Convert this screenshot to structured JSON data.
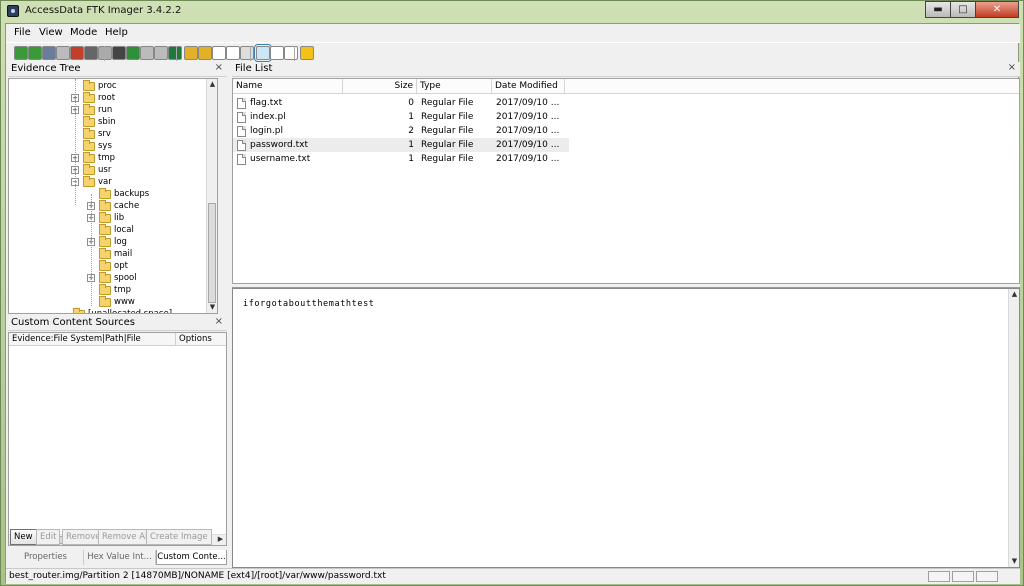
{
  "window": {
    "title": "AccessData FTK Imager 3.4.2.2"
  },
  "menu": [
    "File",
    "View",
    "Mode",
    "Help"
  ],
  "toolbar": {
    "icons": [
      {
        "name": "add-evidence-icon",
        "color": "#3a9a3a"
      },
      {
        "name": "add-all-evidence-icon",
        "color": "#3a9a3a"
      },
      {
        "name": "image-mounting-icon",
        "color": "#6a7d9a"
      },
      {
        "name": "remove-evidence-icon",
        "color": "#bbbbbb"
      },
      {
        "name": "remove-all-evidence-icon",
        "color": "#c2402b"
      },
      {
        "name": "create-image-icon",
        "color": "#666666"
      },
      {
        "name": "export-disk-image-icon",
        "color": "#aaaaaa"
      },
      {
        "name": "export-logical-image-icon",
        "color": "#444444"
      },
      {
        "name": "capture-memory-icon",
        "color": "#2f8f3a"
      },
      {
        "name": "obtain-protected-files-icon",
        "color": "#bbbbbb"
      },
      {
        "name": "detect-efs-icon",
        "color": "#bbbbbb"
      },
      {
        "name": "memory-chip-icon",
        "color": "#1d7a3c"
      },
      {
        "name": "export-files-icon",
        "color": "#e2b128"
      },
      {
        "name": "decrypt-icon",
        "color": "#e2b128"
      },
      {
        "name": "new-page-icon",
        "color": "#ffffff"
      },
      {
        "name": "text-page-icon",
        "color": "#ffffff"
      },
      {
        "name": "export-hash-icon",
        "color": "#dddddd"
      },
      {
        "name": "auto-view-icon",
        "color": "#3c7fb1"
      },
      {
        "name": "text-view-icon",
        "color": "#ffffff"
      },
      {
        "name": "hex-view-icon",
        "color": "#ffffff"
      },
      {
        "name": "help-icon",
        "color": "#f2c21b"
      }
    ]
  },
  "evidence_tree": {
    "title": "Evidence Tree",
    "items": [
      {
        "label": "proc",
        "level": 0,
        "expander": ""
      },
      {
        "label": "root",
        "level": 0,
        "expander": "+"
      },
      {
        "label": "run",
        "level": 0,
        "expander": "+"
      },
      {
        "label": "sbin",
        "level": 0,
        "expander": ""
      },
      {
        "label": "srv",
        "level": 0,
        "expander": ""
      },
      {
        "label": "sys",
        "level": 0,
        "expander": ""
      },
      {
        "label": "tmp",
        "level": 0,
        "expander": "+"
      },
      {
        "label": "usr",
        "level": 0,
        "expander": "+"
      },
      {
        "label": "var",
        "level": 0,
        "expander": "−"
      },
      {
        "label": "backups",
        "level": 1,
        "expander": ""
      },
      {
        "label": "cache",
        "level": 1,
        "expander": "+"
      },
      {
        "label": "lib",
        "level": 1,
        "expander": "+"
      },
      {
        "label": "local",
        "level": 1,
        "expander": ""
      },
      {
        "label": "log",
        "level": 1,
        "expander": "+"
      },
      {
        "label": "mail",
        "level": 1,
        "expander": ""
      },
      {
        "label": "opt",
        "level": 1,
        "expander": ""
      },
      {
        "label": "spool",
        "level": 1,
        "expander": "+"
      },
      {
        "label": "tmp",
        "level": 1,
        "expander": ""
      },
      {
        "label": "www",
        "level": 1,
        "expander": ""
      },
      {
        "label": "[unallocated space]",
        "level": -1,
        "expander": ""
      }
    ]
  },
  "custom_content": {
    "title": "Custom Content Sources",
    "col_source": "Evidence:File System|Path|File",
    "col_options": "Options",
    "buttons": [
      {
        "label": "New",
        "enabled": true
      },
      {
        "label": "Edit",
        "enabled": false
      },
      {
        "label": "Remove",
        "enabled": false
      },
      {
        "label": "Remove All",
        "enabled": false
      },
      {
        "label": "Create Image",
        "enabled": false
      }
    ]
  },
  "bottom_tabs": [
    {
      "label": "Properties",
      "active": false
    },
    {
      "label": "Hex Value Int...",
      "active": false
    },
    {
      "label": "Custom Conte...",
      "active": true
    }
  ],
  "file_list": {
    "title": "File List",
    "columns": [
      "Name",
      "Size",
      "Type",
      "Date Modified"
    ],
    "rows": [
      {
        "name": "flag.txt",
        "size": "0",
        "type": "Regular File",
        "date": "2017/09/10 ...",
        "selected": false
      },
      {
        "name": "index.pl",
        "size": "1",
        "type": "Regular File",
        "date": "2017/09/10 ...",
        "selected": false
      },
      {
        "name": "login.pl",
        "size": "2",
        "type": "Regular File",
        "date": "2017/09/10 ...",
        "selected": false
      },
      {
        "name": "password.txt",
        "size": "1",
        "type": "Regular File",
        "date": "2017/09/10 ...",
        "selected": true
      },
      {
        "name": "username.txt",
        "size": "1",
        "type": "Regular File",
        "date": "2017/09/10 ...",
        "selected": false
      }
    ]
  },
  "viewer": {
    "content": "iforgotaboutthemathtest"
  },
  "status": {
    "path": "best_router.img/Partition 2 [14870MB]/NONAME [ext4]/[root]/var/www/password.txt"
  },
  "window_controls": {
    "minimize": "▬",
    "maximize": "□",
    "close": "✕"
  },
  "close_glyph": "×",
  "scroll_glyphs": {
    "up": "▲",
    "down": "▼",
    "left": "◀",
    "right": "▶"
  }
}
